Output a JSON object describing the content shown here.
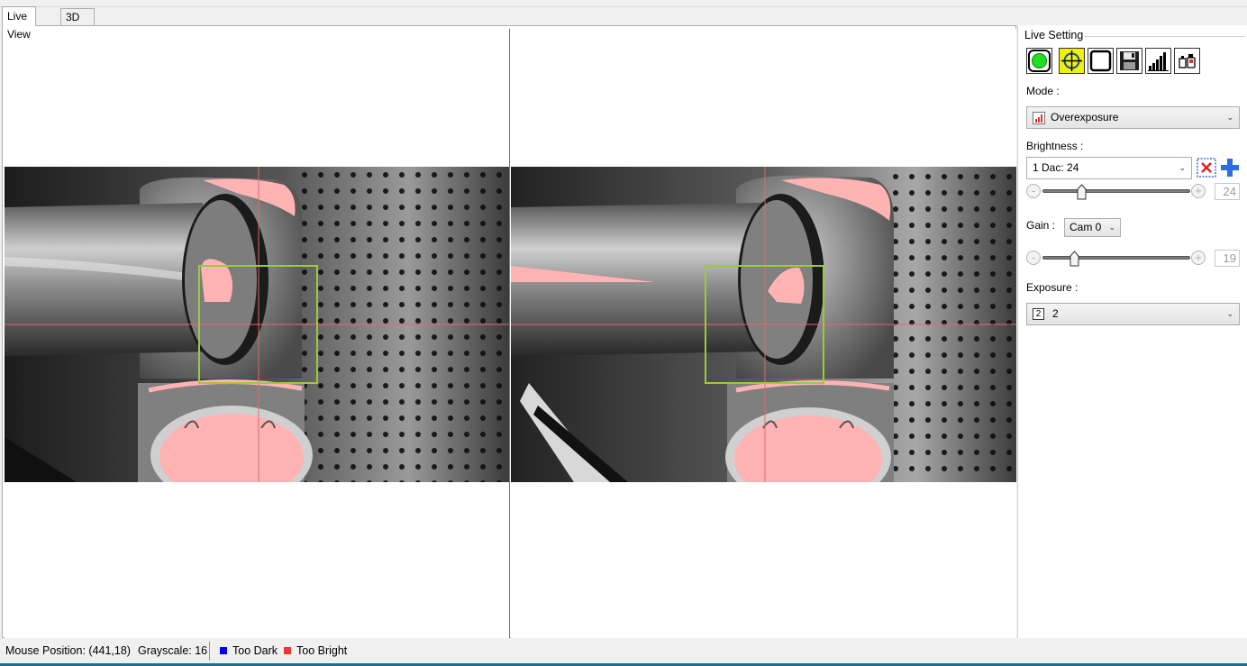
{
  "tabs": [
    {
      "label": "Live View",
      "active": true
    },
    {
      "label": "3D View",
      "active": false
    }
  ],
  "panel": {
    "title": "Live Setting",
    "toolbar_icons": [
      "live-start-icon",
      "crosshair-icon",
      "frame-icon",
      "save-icon",
      "histogram-icon",
      "camera-tools-icon"
    ],
    "mode_label": "Mode :",
    "mode_value": "Overexposure",
    "brightness_label": "Brightness :",
    "brightness_value": "1 Dac: 24",
    "brightness_slider": {
      "value": "24",
      "min": "-",
      "max": "+"
    },
    "gain_label": "Gain :",
    "gain_cam": "Cam 0",
    "gain_slider": {
      "value": "19",
      "min": "-",
      "max": "+"
    },
    "exposure_label": "Exposure :",
    "exposure_value": "2",
    "exposure_icon_text": "2"
  },
  "status": {
    "mouse_position": "Mouse Position: (441,18)",
    "grayscale": "Grayscale: 16",
    "too_dark": "Too Dark",
    "too_bright": "Too Bright",
    "too_dark_color": "#0000ee",
    "too_bright_color": "#ee3333"
  },
  "overlay_colors": {
    "overexposure": "#ffb3b3",
    "roi_box": "#9acd32",
    "crosshair": "#e06a6a"
  }
}
